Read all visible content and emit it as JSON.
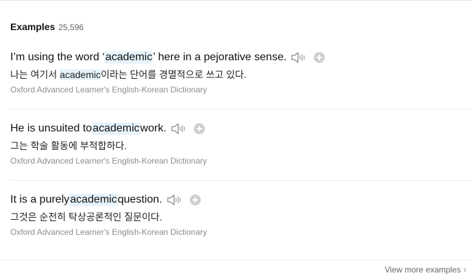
{
  "header": {
    "title": "Examples",
    "count": "25,596"
  },
  "examples": [
    {
      "en_before": "I’m using the word ‘",
      "en_highlight": "academic",
      "en_after": "’ here in a pejorative sense.",
      "ko_before": "나는 여기서 ",
      "ko_highlight": "academic",
      "ko_after": "이라는 단어를 경멸적으로 쓰고 있다.",
      "source": "Oxford Advanced Learner's English-Korean Dictionary"
    },
    {
      "en_before": "He is unsuited to ",
      "en_highlight": "academic",
      "en_after": " work.",
      "ko": "그는 학술 활동에 부적합하다.",
      "source": "Oxford Advanced Learner's English-Korean Dictionary"
    },
    {
      "en_before": "It is a purely ",
      "en_highlight": "academic",
      "en_after": " question.",
      "ko": "그것은 순전히 탁상공론적인 질문이다.",
      "source": "Oxford Advanced Learner's English-Korean Dictionary"
    }
  ],
  "footer": {
    "view_more_label": "View more examples",
    "chevron_icon": "chevron-right-icon"
  },
  "icons": {
    "speaker": "speaker-icon",
    "add": "plus-circle-icon"
  },
  "colors": {
    "highlight": "#e6f3fc",
    "source_text": "#8c8c8c"
  }
}
